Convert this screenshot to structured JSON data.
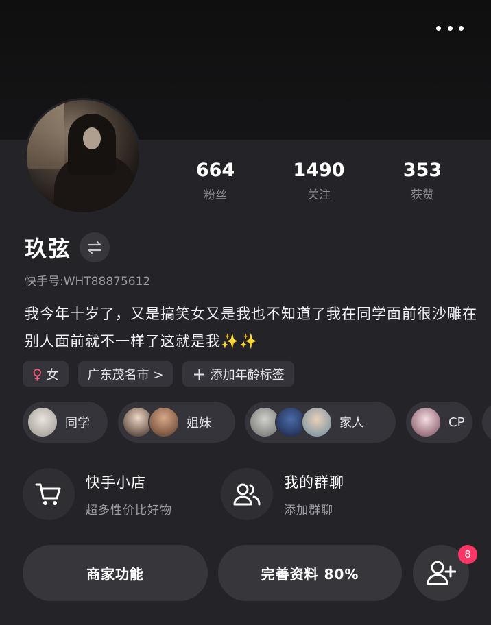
{
  "header": {
    "more_icon": "more-horizontal-icon"
  },
  "profile": {
    "name": "玖弦",
    "switch_icon": "switch-arrows-icon",
    "uid_text": "快手号:WHT88875612",
    "bio": "我今年十岁了，又是搞笑女又是我也不知道了我在同学面前很沙雕在别人面前就不一样了这就是我✨✨"
  },
  "stats": [
    {
      "value": "664",
      "label": "粉丝"
    },
    {
      "value": "1490",
      "label": "关注"
    },
    {
      "value": "353",
      "label": "获赞"
    }
  ],
  "tags": {
    "gender_icon": "female-icon",
    "gender": "女",
    "location": "广东茂名市 >",
    "add_age": "添加年龄标签"
  },
  "relations": [
    {
      "label": "同学"
    },
    {
      "label": "姐妹"
    },
    {
      "label": "家人"
    },
    {
      "label": "CP"
    }
  ],
  "shortcuts": {
    "shop": {
      "title": "快手小店",
      "subtitle": "超多性价比好物",
      "icon": "shopping-cart-icon"
    },
    "group": {
      "title": "我的群聊",
      "subtitle": "添加群聊",
      "icon": "group-users-icon"
    }
  },
  "actions": {
    "merchant": "商家功能",
    "complete_profile": "完善资料 80%",
    "add_friend_icon": "add-user-icon",
    "add_friend_badge": "8"
  },
  "colors": {
    "background": "#242428",
    "badge": "#fe3666",
    "female": "#ff5a7a"
  }
}
